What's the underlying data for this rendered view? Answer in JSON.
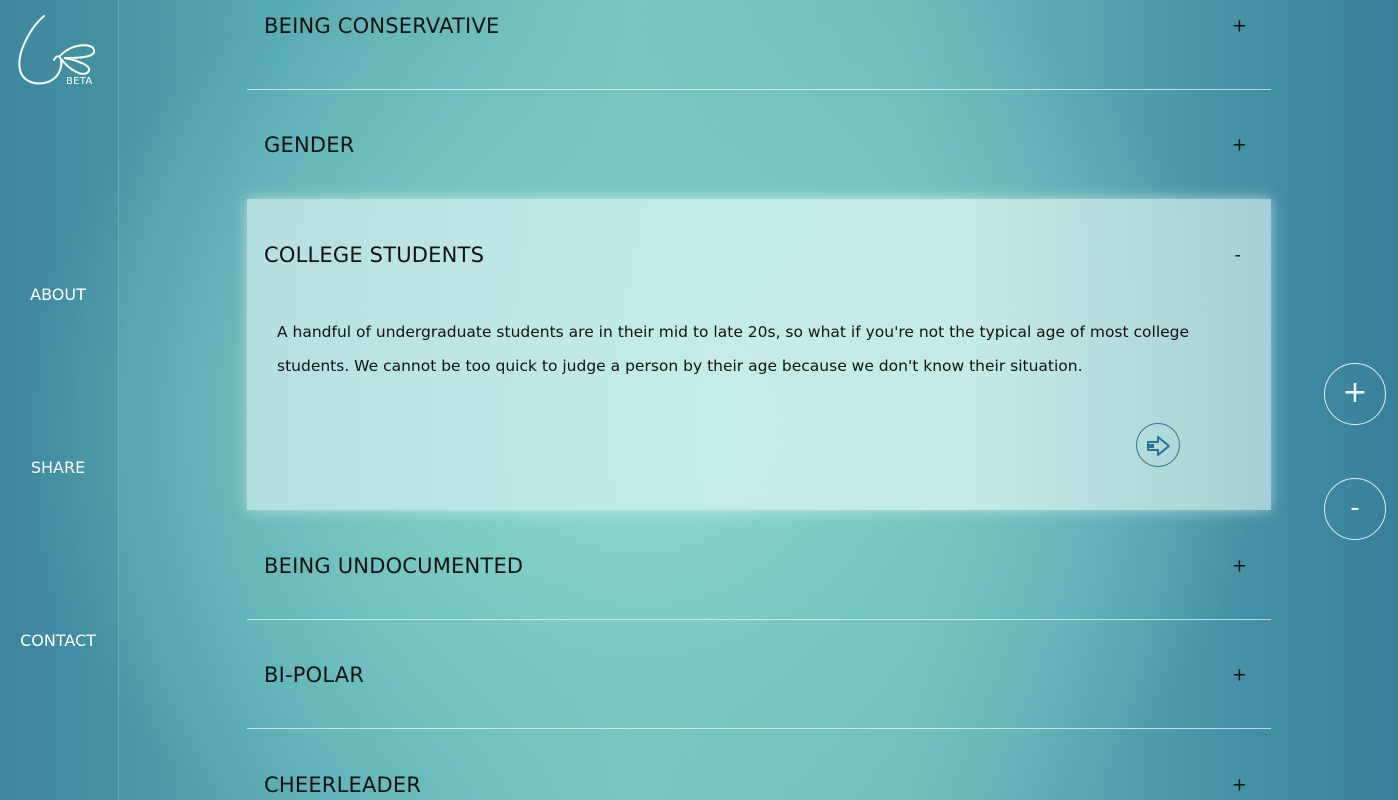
{
  "sidebar": {
    "logo_badge": "BETA",
    "nav": {
      "about": "ABOUT",
      "share": "SHARE",
      "contact": "CONTACT"
    }
  },
  "accordion": {
    "items": [
      {
        "title": "BEING CONSERVATIVE",
        "toggle": "+",
        "expanded": false
      },
      {
        "title": "GENDER",
        "toggle": "+",
        "expanded": false
      },
      {
        "title": "COLLEGE STUDENTS",
        "toggle": "-",
        "expanded": true,
        "body": "A handful of undergraduate students are in their mid to late 20s, so what if you're not the typical age of most college students. We cannot be too quick to judge a person by their age because we don't know their situation."
      },
      {
        "title": "BEING UNDOCUMENTED",
        "toggle": "+",
        "expanded": false
      },
      {
        "title": "BI-POLAR",
        "toggle": "+",
        "expanded": false
      },
      {
        "title": "CHEERLEADER",
        "toggle": "+",
        "expanded": false
      }
    ]
  },
  "zoom": {
    "in_label": "+",
    "out_label": "-"
  },
  "icons": {
    "logo": "ribbon-logo-icon",
    "next": "arrow-right-icon"
  },
  "colors": {
    "accent": "#2f6f95",
    "text": "#111111",
    "nav_text": "#ffffff"
  }
}
